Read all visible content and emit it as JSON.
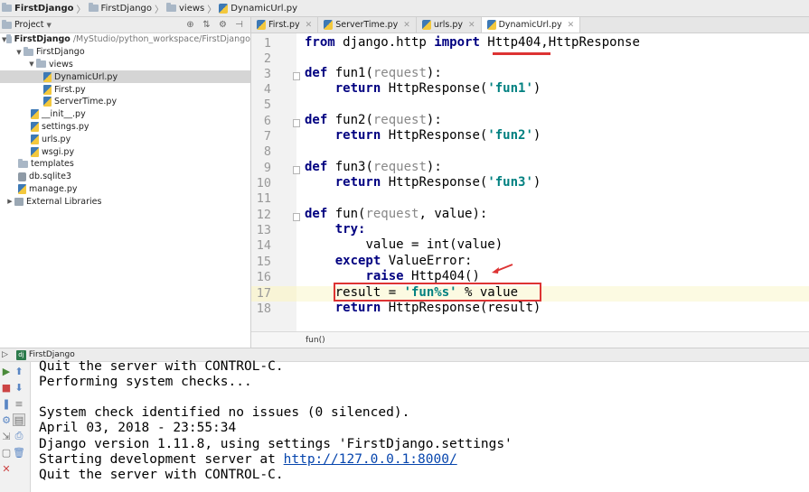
{
  "breadcrumb": [
    "FirstDjango",
    "FirstDjango",
    "views",
    "DynamicUrl.py"
  ],
  "project_panel": {
    "header_label": "Project",
    "tree": [
      {
        "label": "FirstDjango",
        "note": "/MyStudio/python_workspace/FirstDjango",
        "bold": true
      },
      {
        "label": "FirstDjango"
      },
      {
        "label": "views"
      },
      {
        "label": "DynamicUrl.py",
        "selected": true
      },
      {
        "label": "First.py"
      },
      {
        "label": "ServerTime.py"
      },
      {
        "label": "__init__.py"
      },
      {
        "label": "settings.py"
      },
      {
        "label": "urls.py"
      },
      {
        "label": "wsgi.py"
      },
      {
        "label": "templates"
      },
      {
        "label": "db.sqlite3"
      },
      {
        "label": "manage.py"
      },
      {
        "label": "External Libraries"
      }
    ]
  },
  "tabs": [
    {
      "label": "First.py"
    },
    {
      "label": "ServerTime.py"
    },
    {
      "label": "urls.py"
    },
    {
      "label": "DynamicUrl.py",
      "active": true
    }
  ],
  "editor": {
    "line_numbers": [
      "1",
      "2",
      "3",
      "4",
      "5",
      "6",
      "7",
      "8",
      "9",
      "10",
      "11",
      "12",
      "13",
      "14",
      "15",
      "16",
      "17",
      "18"
    ],
    "lines": {
      "l1a": "from",
      "l1b": " django.http ",
      "l1c": "import",
      "l1d": " Http404,HttpResponse",
      "def": "def",
      "l3b": " fun1(",
      "l3p": "request",
      "l3c": "):",
      "ret": "return",
      "l4b": " HttpResponse(",
      "l4s": "'fun1'",
      "l4c": ")",
      "l6b": " fun2(",
      "l6p": "request",
      "l6c": "):",
      "l7b": " HttpResponse(",
      "l7s": "'fun2'",
      "l7c": ")",
      "l9b": " fun3(",
      "l9p": "request",
      "l9c": "):",
      "l10b": " HttpResponse(",
      "l10s": "'fun3'",
      "l10c": ")",
      "l12b": " fun(",
      "l12p": "request",
      "l12c": ", value):",
      "l13": "try:",
      "l14": "value = int(value)",
      "l15a": "except",
      "l15b": " ValueError:",
      "l16a": "raise",
      "l16b": " Http404()",
      "l17a": "result = ",
      "l17s": "'fun%s'",
      "l17b": " % value",
      "l18b": " HttpResponse(result)"
    },
    "status_function": "fun()"
  },
  "run_panel": {
    "title": "FirstDjango",
    "console": [
      "Quit the server with CONTROL-C.",
      "Performing system checks...",
      "",
      "System check identified no issues (0 silenced).",
      "April 03, 2018 - 23:55:34",
      "Django version 1.11.8, using settings 'FirstDjango.settings'",
      "Starting development server at ",
      "Quit the server with CONTROL-C."
    ],
    "server_link": "http://127.0.0.1:8000/"
  },
  "colors": {
    "annotation": "#dd3333",
    "keyword": "#000080",
    "string": "#008080"
  }
}
